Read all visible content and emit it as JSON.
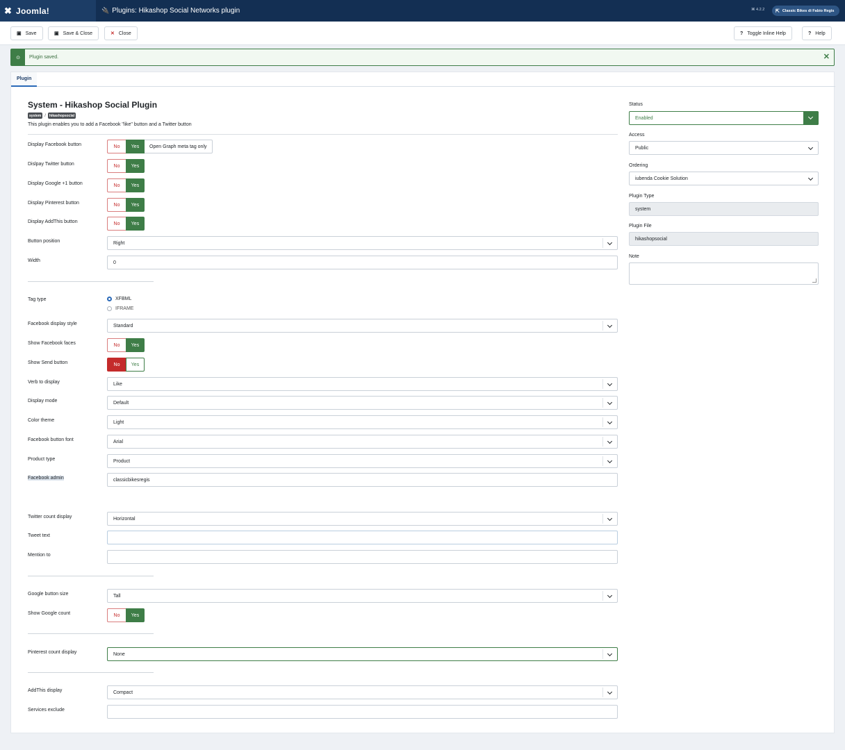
{
  "app": {
    "logo": "Joomla!",
    "page_title": "Plugins: Hikashop Social Networks plugin",
    "version": "⌘ 4.2.2",
    "site_name": "Classic Bikes di Fabio Regis"
  },
  "toolbar": {
    "save": "Save",
    "save_close": "Save & Close",
    "close": "Close",
    "toggle_help": "Toggle Inline Help",
    "help": "Help"
  },
  "alert": {
    "message": "Plugin saved."
  },
  "tabs": [
    "Plugin"
  ],
  "plugin": {
    "title": "System - Hikashop Social Plugin",
    "badge_group": "system",
    "badge_element": "hikashopsocial",
    "badge_sep": "/",
    "description": "This plugin enables you to add a Facebook \"like\" button and a Twitter button"
  },
  "switch": {
    "no": "No",
    "yes": "Yes",
    "og_only": "Open Graph meta tag only"
  },
  "fields": {
    "display_facebook": "Display Facebook button",
    "display_twitter": "Dislpay Twitter button",
    "display_google": "Display Google +1 button",
    "display_pinterest": "Display Pinterest button",
    "display_addthis": "Display AddThis button",
    "button_position": {
      "label": "Button position",
      "value": "Right"
    },
    "width": {
      "label": "Width",
      "value": "0"
    },
    "tag_type": {
      "label": "Tag type",
      "options": [
        "XFBML",
        "IFRAME"
      ],
      "selected": "XFBML"
    },
    "fb_display_style": {
      "label": "Facebook display style",
      "value": "Standard"
    },
    "show_fb_faces": "Show Facebook faces",
    "show_send": "Show Send button",
    "verb": {
      "label": "Verb to display",
      "value": "Like"
    },
    "display_mode": {
      "label": "Display mode",
      "value": "Default"
    },
    "color_theme": {
      "label": "Color theme",
      "value": "Light"
    },
    "fb_font": {
      "label": "Facebook button font",
      "value": "Arial"
    },
    "product_type": {
      "label": "Product type",
      "value": "Product"
    },
    "fb_admin": {
      "label": "Facebook admin",
      "value": "classicbikesregis"
    },
    "twitter_count": {
      "label": "Twitter count display",
      "value": "Horizontal"
    },
    "tweet_text": {
      "label": "Tweet text",
      "value": ""
    },
    "mention_to": {
      "label": "Mention to",
      "value": ""
    },
    "google_size": {
      "label": "Google button size",
      "value": "Tall"
    },
    "show_google_count": "Show Google count",
    "pinterest_count": {
      "label": "Pinterest count display",
      "value": "None"
    },
    "addthis_display": {
      "label": "AddThis display",
      "value": "Compact"
    },
    "services_exclude": {
      "label": "Services exclude",
      "value": ""
    }
  },
  "sidebar": {
    "status": {
      "label": "Status",
      "value": "Enabled"
    },
    "access": {
      "label": "Access",
      "value": "Public"
    },
    "ordering": {
      "label": "Ordering",
      "value": "iubenda Cookie Solution"
    },
    "plugin_type": {
      "label": "Plugin Type",
      "value": "system"
    },
    "plugin_file": {
      "label": "Plugin File",
      "value": "hikashopsocial"
    },
    "note": {
      "label": "Note",
      "value": ""
    }
  },
  "colors": {
    "navbar": "#132f53",
    "success": "#3e7d47",
    "danger": "#c42b2b",
    "accent": "#2a69b8"
  },
  "icons": {
    "logo": "joomla-icon",
    "plugin": "plug-icon",
    "site": "external-link-icon",
    "save": "save-icon",
    "save_close": "save-icon",
    "close": "close-icon",
    "help_toggle": "question-circle-icon",
    "help": "question-icon",
    "alert": "check-circle-icon",
    "dismiss": "close-icon"
  }
}
